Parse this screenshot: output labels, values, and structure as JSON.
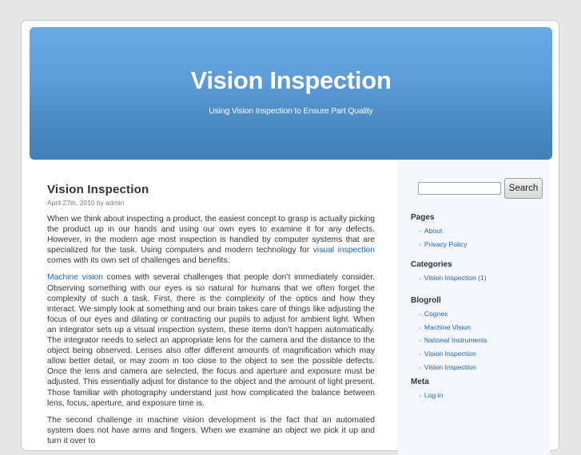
{
  "header": {
    "blog_title": "Vision Inspection",
    "blog_description": "Using Vision Inspection to Ensure Part Quality",
    "colors": {
      "gradient_top": "#69aae6",
      "gradient_bottom": "#437fb7"
    }
  },
  "post": {
    "title": "Vision Inspection",
    "meta": "April 27th, 2010 by admin",
    "paragraphs": [
      {
        "before": "When we think about inspecting a product, the easiest concept to grasp is actually picking the product up in our hands and using our own eyes to examine it for any defects. However, in the modern age most inspection is handled by computer systems that are specialized for the task. Using computers and modern technology for ",
        "link": "visual inspection",
        "after": " comes with its own set of challenges and benefits."
      },
      {
        "before": "",
        "link": "Machine vision",
        "after": " comes with several challenges that people don’t immediately consider. Observing something with our eyes is so natural for humans that we often forget the complexity of such a task. First, there is the complexity of the optics and how they interact. We simply look at something and our brain takes care of things like adjusting the focus of our eyes and dilating or contracting our pupils to adjust for ambient light. When an integrator sets up a visual inspection system, these items don’t happen automatically. The integrator needs to select an appropriate lens for the camera and the distance to the object being observed. Lenses also offer different amounts of magnification which may allow better detail, or may zoom in too close to the object to see the possible defects. Once the lens and camera are selected, the focus and aperture and exposure must be adjusted. This essentially adjust for distance to the object and the amount of light present. Those familiar with photography understand just how complicated the balance between lens, focus, aperture, and exposure time is."
      },
      {
        "before": "The second challenge in machine vision development is the fact that an automated system does not have arms and fingers. When we examine an object we pick it up and turn it over to",
        "link": "",
        "after": ""
      }
    ],
    "link_color": "#2164c0"
  },
  "sidebar": {
    "search": {
      "input_value": "",
      "button_label": "Search"
    },
    "bullet": "»",
    "widgets": {
      "pages": {
        "title": "Pages",
        "items": [
          "About",
          "Privacy Policy"
        ]
      },
      "categories": {
        "title": "Categories",
        "items": [
          {
            "label": "Vision Inspection",
            "count": "(1)"
          }
        ]
      },
      "blogroll": {
        "title": "Blogroll",
        "items": [
          "Cognex",
          "Machine Vision",
          "National Instruments",
          "Vision Inspection",
          "Vision Inspection"
        ]
      },
      "meta": {
        "title": "Meta",
        "items": [
          "Log in"
        ]
      }
    }
  }
}
